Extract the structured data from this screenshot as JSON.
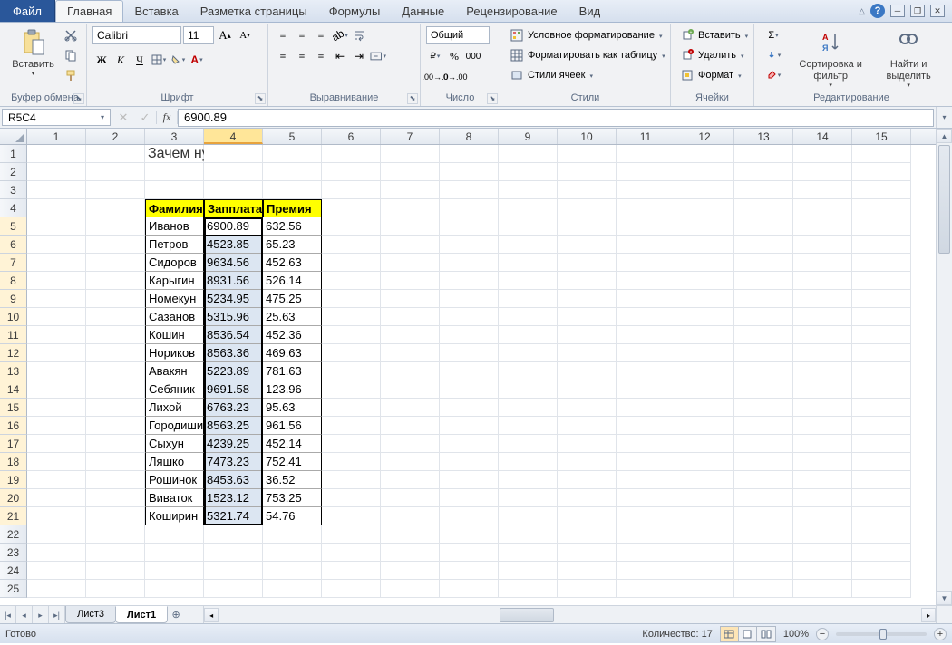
{
  "titlebar": {
    "file": "Файл",
    "tabs": [
      "Главная",
      "Вставка",
      "Разметка страницы",
      "Формулы",
      "Данные",
      "Рецензирование",
      "Вид"
    ],
    "active_tab": 0
  },
  "ribbon": {
    "clipboard": {
      "label": "Буфер обмена",
      "paste": "Вставить"
    },
    "font": {
      "label": "Шрифт",
      "name": "Calibri",
      "size": "11"
    },
    "alignment": {
      "label": "Выравнивание"
    },
    "number": {
      "label": "Число",
      "format": "Общий"
    },
    "styles": {
      "label": "Стили",
      "conditional": "Условное форматирование",
      "table": "Форматировать как таблицу",
      "cell": "Стили ячеек"
    },
    "cells": {
      "label": "Ячейки",
      "insert": "Вставить",
      "delete": "Удалить",
      "format": "Формат"
    },
    "editing": {
      "label": "Редактирование",
      "sort": "Сортировка и фильтр",
      "find": "Найти и выделить"
    }
  },
  "formula_bar": {
    "name_box": "R5C4",
    "formula": "6900.89"
  },
  "grid": {
    "title_row": 1,
    "title_col": 3,
    "title_text": "Зачем нужен поиск в Excel? Какие его преимущества?",
    "header_row": 4,
    "headers": [
      "Фамилия",
      "Запплата",
      "Премия"
    ],
    "data_start_row": 5,
    "rows": [
      {
        "name": "Иванов",
        "salary": "6900.89",
        "bonus": "632.56"
      },
      {
        "name": "Петров",
        "salary": "4523.85",
        "bonus": "65.23"
      },
      {
        "name": "Сидоров",
        "salary": "9634.56",
        "bonus": "452.63"
      },
      {
        "name": "Карыгин",
        "salary": "8931.56",
        "bonus": "526.14"
      },
      {
        "name": "Номекун",
        "salary": "5234.95",
        "bonus": "475.25"
      },
      {
        "name": "Сазанов",
        "salary": "5315.96",
        "bonus": "25.63"
      },
      {
        "name": "Кошин",
        "salary": "8536.54",
        "bonus": "452.36"
      },
      {
        "name": "Нориков",
        "salary": "8563.36",
        "bonus": "469.63"
      },
      {
        "name": "Авакян",
        "salary": "5223.89",
        "bonus": "781.63"
      },
      {
        "name": "Себяник",
        "salary": "9691.58",
        "bonus": "123.96"
      },
      {
        "name": "Лихой",
        "salary": "6763.23",
        "bonus": "95.63"
      },
      {
        "name": "Городишин",
        "salary": "8563.25",
        "bonus": "961.56"
      },
      {
        "name": "Сыхун",
        "salary": "4239.25",
        "bonus": "452.14"
      },
      {
        "name": "Ляшко",
        "salary": "7473.23",
        "bonus": "752.41"
      },
      {
        "name": "Рошинок",
        "salary": "8453.63",
        "bonus": "36.52"
      },
      {
        "name": "Виваток",
        "salary": "1523.12",
        "bonus": "753.25"
      },
      {
        "name": "Коширин",
        "salary": "5321.74",
        "bonus": "54.76"
      }
    ],
    "selection": {
      "col": 4,
      "row_start": 5,
      "row_end": 21,
      "active_row": 5
    },
    "visible_cols": 15,
    "visible_rows": 25
  },
  "sheets": {
    "tabs": [
      "Лист3",
      "Лист1"
    ],
    "active": 1
  },
  "status": {
    "ready": "Готово",
    "count_label": "Количество:",
    "count_value": "17",
    "zoom": "100%"
  }
}
